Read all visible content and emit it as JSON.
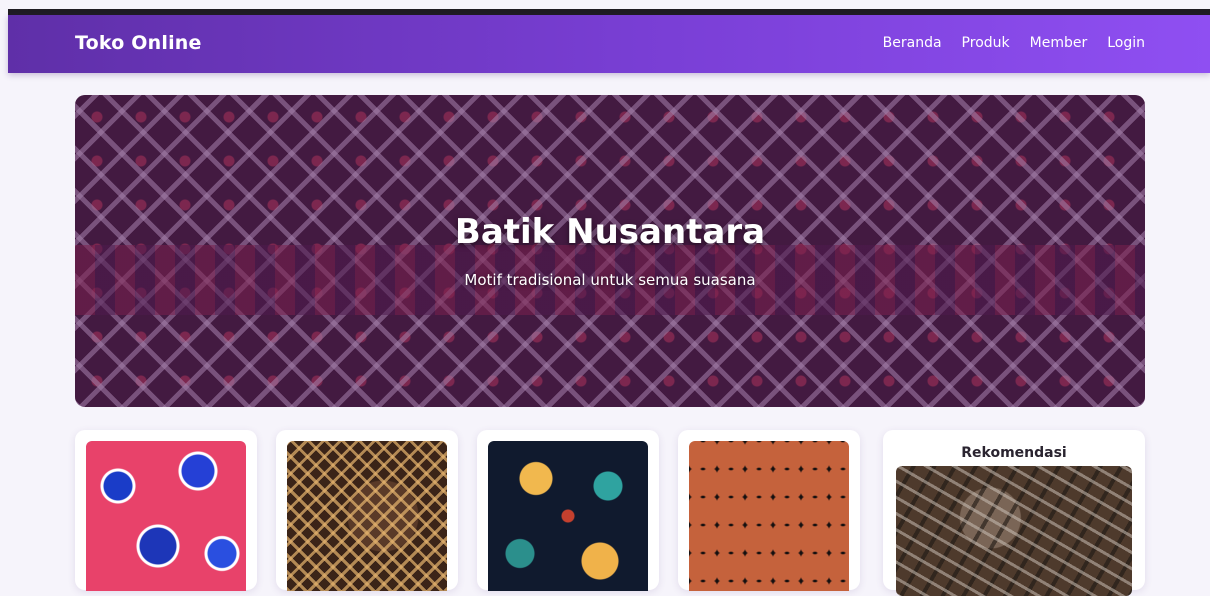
{
  "navbar": {
    "brand": "Toko Online",
    "links": [
      "Beranda",
      "Produk",
      "Member",
      "Login"
    ]
  },
  "hero": {
    "title": "Batik Nusantara",
    "subtitle": "Motif tradisional untuk semua suasana"
  },
  "recommendation": {
    "title": "Rekomendasi"
  },
  "colors": {
    "navbar_start": "#5f2fa8",
    "navbar_end": "#8f4ff2",
    "page_bg": "#f6f4fb"
  }
}
